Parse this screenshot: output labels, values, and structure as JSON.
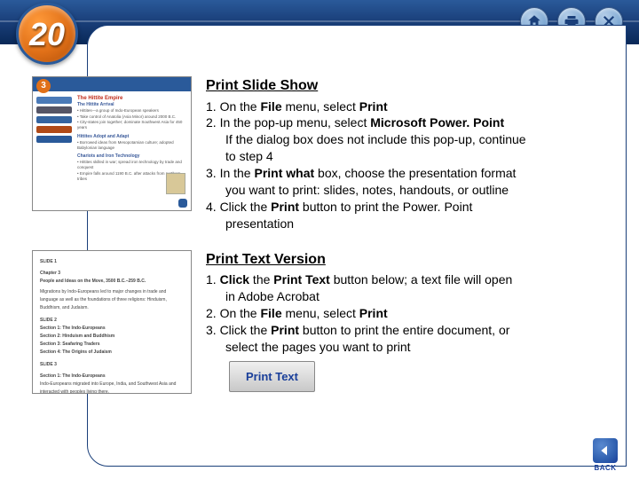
{
  "chapter_number": "20",
  "icons": {
    "home": "home-icon",
    "print": "print-icon",
    "close": "close-icon"
  },
  "thumb1": {
    "badge": "3",
    "title": "The Hittite Empire",
    "sub1": "The Hittite Arrival",
    "b1": "• Hittites—a group of Indo-European speakers",
    "b2": "• Take control of Anatolia (Asia Minor) around 2000 B.C.",
    "b3": "• City-states join together; dominate Southwest Asia for 450 years",
    "sub2": "Hittites Adopt and Adapt",
    "b4": "• Borrowed ideas from Mesopotamian culture; adopted Babylonian language",
    "sub3": "Chariots and Iron Technology",
    "b5": "• Hittites skilled in war; spread iron technology by trade and conquest",
    "b6": "• Empire falls around 1190 B.C. after attacks from northern tribes"
  },
  "thumb2": {
    "s1": "SLIDE 1",
    "ch": "Chapter 3",
    "chsub": "People and Ideas on the Move, 3500 B.C.–259 B.C.",
    "p1": "Migrations by Indo-Europeans led to major changes in trade and language as well as the foundations of three religions: Hinduism, Buddhism, and Judaism.",
    "s2": "SLIDE 2",
    "l1": "Section 1: The Indo-Europeans",
    "l2": "Section 2: Hinduism and Buddhism",
    "l3": "Section 3: Seafaring Traders",
    "l4": "Section 4: The Origins of Judaism",
    "s3": "SLIDE 3",
    "sec1": "Section 1: The Indo-Europeans",
    "p2": "Indo-Europeans migrated into Europe, India, and Southwest Asia and interacted with peoples living there."
  },
  "section_a": {
    "title": "Print Slide Show",
    "l1": "1.  On the ",
    "l1b": "File",
    "l1c": " menu, select ",
    "l1d": "Print",
    "l2": "2.  In the pop-up menu, select ",
    "l2b": "Microsoft Power. Point",
    "l3": "If the dialog box does not include this pop-up, continue",
    "l3b": "to step 4",
    "l4": "3.  In the ",
    "l4b": "Print what",
    "l4c": " box, choose the presentation format",
    "l5": "you want to print: slides, notes, handouts, or outline",
    "l6": "4. Click the ",
    "l6b": "Print",
    "l6c": " button to print the Power. Point",
    "l7": "presentation"
  },
  "section_b": {
    "title": "Print Text Version",
    "l1": "1.  ",
    "l1b": "Click",
    "l1c": " the ",
    "l1d": "Print Text",
    "l1e": " button below; a text file will open",
    "l2": "in  Adobe Acrobat",
    "l3": "2.  On the ",
    "l3b": "File",
    "l3c": " menu, select ",
    "l3d": "Print",
    "l4": "3.  Click the ",
    "l4b": "Print",
    "l4c": " button to print the entire document, or",
    "l5": "select the pages you want to print",
    "button": "Print Text"
  },
  "back_label": "BACK"
}
